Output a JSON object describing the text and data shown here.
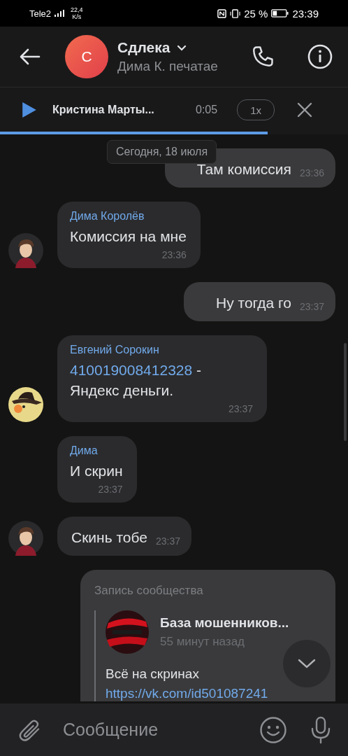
{
  "status_bar": {
    "carrier": "Tele2",
    "speed": "22,4",
    "speed_unit": "K/s",
    "battery": "25 %",
    "time": "23:39"
  },
  "header": {
    "avatar_letter": "С",
    "title": "Сдлека",
    "subtitle": "Дима К. печатае"
  },
  "player": {
    "title": "Кристина Марты...",
    "time": "0:05",
    "speed": "1x",
    "level": 0.77
  },
  "date": "Сегодня, 18 июля",
  "messages": [
    {
      "kind": "out",
      "text": "Там комиссия",
      "time": "23:36"
    },
    {
      "kind": "in",
      "avatar": true,
      "sender": "Дима Королёв",
      "text": "Комиссия на мне",
      "time": "23:36"
    },
    {
      "kind": "out",
      "text": "Ну тогда го",
      "time": "23:37"
    },
    {
      "kind": "in",
      "avatar": true,
      "sender": "Евгений Сорокин",
      "link": "410019008412328",
      "text": " - Яндекс деньги.",
      "time": "23:37"
    },
    {
      "kind": "in",
      "sender": "Дима",
      "text": "И скрин",
      "time": "23:37"
    },
    {
      "kind": "in_short",
      "avatar": true,
      "text": "Скинь тобе",
      "time": "23:37"
    },
    {
      "kind": "repost",
      "label": "Запись сообщества",
      "community": "База мошенников...",
      "ago": "55 минут назад",
      "text": "Всё на скринах",
      "link": "https://vk.com/id501087241"
    }
  ],
  "composer": {
    "placeholder": "Сообщение"
  }
}
